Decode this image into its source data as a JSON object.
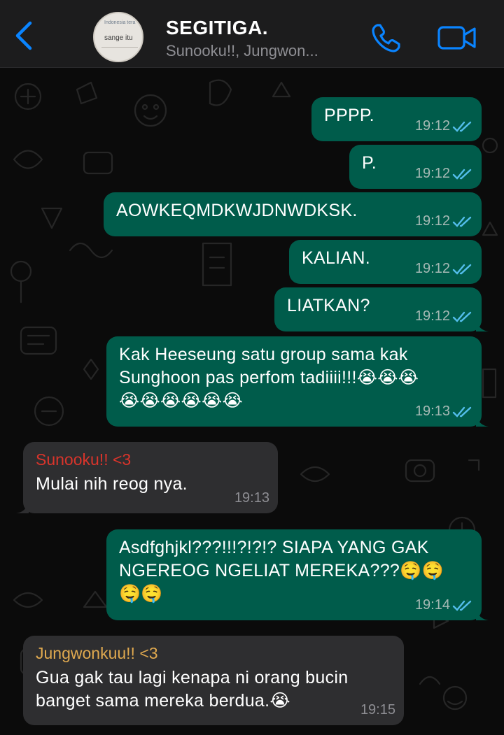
{
  "header": {
    "title": "SEGITIGA.",
    "subtitle": "Sunooku!!, Jungwon...",
    "avatar_text_1": "Indonesia tera",
    "avatar_text_2": "sange itu",
    "back_icon": "chevron-left-icon",
    "call_icon": "phone-icon",
    "video_icon": "video-camera-icon"
  },
  "colors": {
    "accent": "#0a84ff",
    "outgoing_bubble": "#005c4b",
    "incoming_bubble": "#2e2e30",
    "sender_sunoo": "#d9342b",
    "sender_jungwon": "#e0a94f",
    "read_tick": "#53bdeb"
  },
  "messages": [
    {
      "direction": "out",
      "text": "PPPP.",
      "time": "19:12",
      "status": "read"
    },
    {
      "direction": "out",
      "text": "P.",
      "time": "19:12",
      "status": "read"
    },
    {
      "direction": "out",
      "text": "AOWKEQMDKWJDNWDKSK.",
      "time": "19:12",
      "status": "read"
    },
    {
      "direction": "out",
      "text": "KALIAN.",
      "time": "19:12",
      "status": "read"
    },
    {
      "direction": "out",
      "text": "LIATKAN?",
      "time": "19:12",
      "status": "read"
    },
    {
      "direction": "out",
      "text": "Kak Heeseung satu group sama kak\nSunghoon pas perfom tadiiii!!!😭😭😭\n😭😭😭😭😭😭",
      "time": "19:13",
      "status": "read"
    },
    {
      "direction": "in",
      "sender": "Sunooku!! <3",
      "text": "Mulai nih reog nya.",
      "time": "19:13"
    },
    {
      "direction": "out",
      "text": "Asdfghjkl???!!!?!?!? SIAPA YANG GAK\nNGEREOG NGELIAT MEREKA???🤤🤤\n🤤🤤",
      "time": "19:14",
      "status": "read"
    },
    {
      "direction": "in",
      "sender": "Jungwonkuu!! <3",
      "text": "Gua gak tau lagi kenapa ni orang bucin\nbanget sama mereka berdua.😭",
      "time": "19:15"
    }
  ]
}
